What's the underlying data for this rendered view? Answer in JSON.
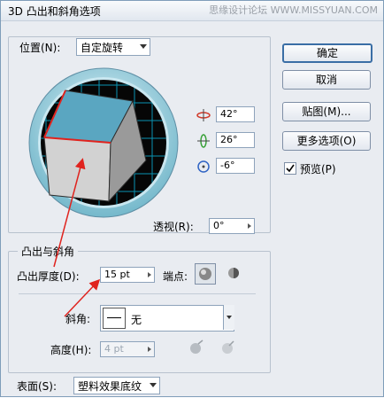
{
  "dialog": {
    "title": "3D 凸出和斜角选项",
    "watermark": "思缘设计论坛 WWW.MISSYUAN.COM"
  },
  "position": {
    "label": "位置(N):",
    "value": "自定旋转",
    "x_rotation": "42°",
    "y_rotation": "26°",
    "z_rotation": "-6°",
    "perspective_label": "透视(R):",
    "perspective_value": "0°"
  },
  "buttons": {
    "ok": "确定",
    "cancel": "取消",
    "map": "贴图(M)...",
    "more_options": "更多选项(O)"
  },
  "preview": {
    "label": "预览(P)",
    "checked": true
  },
  "extrude_bevel": {
    "group_label": "凸出与斜角",
    "depth_label": "凸出厚度(D):",
    "depth_value": "15 pt",
    "cap_label": "端点:",
    "bevel_label": "斜角:",
    "bevel_value": "无",
    "height_label": "高度(H):",
    "height_value": "4 pt"
  },
  "surface": {
    "label": "表面(S):",
    "value": "塑料效果底纹"
  },
  "colors": {
    "cube_top": "#5aa6c1",
    "cube_front": "#d2d2d2",
    "cube_right": "#9a9a9a",
    "edge_highlight": "#e0231e",
    "dial_ring": "#74b8cb",
    "grid": "#0aa3c5"
  },
  "icons": [
    "close-icon",
    "rotate-x-icon",
    "rotate-y-icon",
    "rotate-z-icon",
    "cap-on-icon",
    "cap-off-icon",
    "bevel-out-icon",
    "bevel-in-icon"
  ]
}
